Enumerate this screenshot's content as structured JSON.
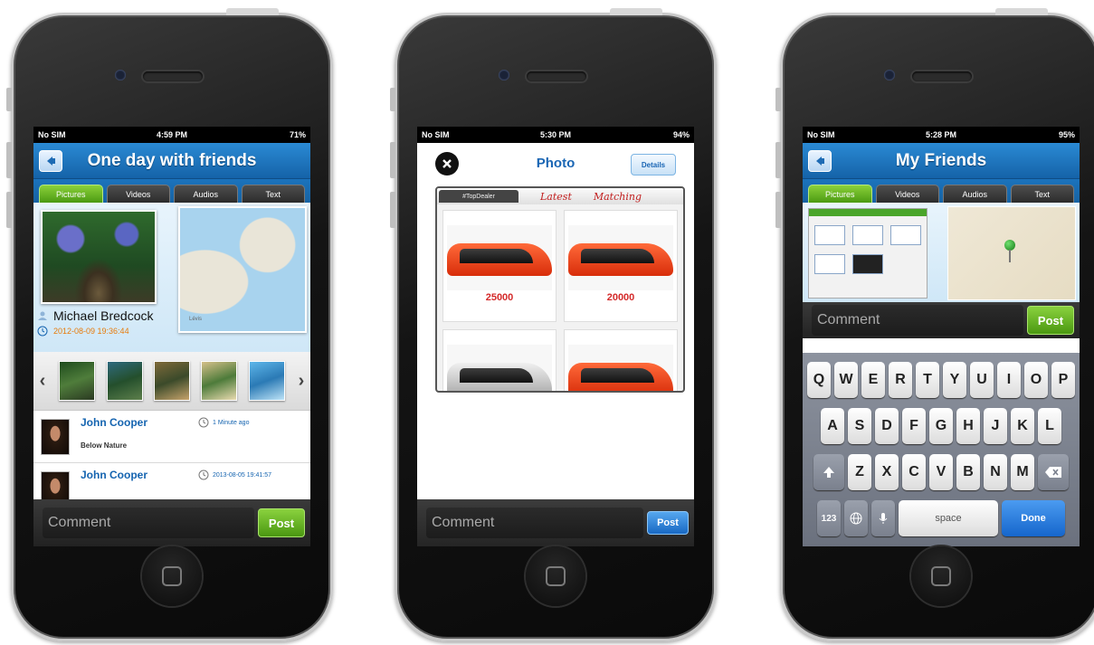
{
  "phones": [
    {
      "status": {
        "carrier": "No SIM",
        "time": "4:59 PM",
        "battery": "71%"
      },
      "nav_title": "One day with friends",
      "tabs": [
        "Pictures",
        "Videos",
        "Audios",
        "Text"
      ],
      "author": "Michael Bredcock",
      "date": "2012-08-09 19:36:44",
      "map_label": "Lévis",
      "comments": [
        {
          "name": "John Cooper",
          "time": "1 Minute ago",
          "text": "Below Nature"
        },
        {
          "name": "John Cooper",
          "time": "2013-08-05 19:41:57",
          "text": ""
        }
      ],
      "comment_placeholder": "Comment",
      "post_label": "Post"
    },
    {
      "status": {
        "carrier": "No SIM",
        "time": "5:30 PM",
        "battery": "94%"
      },
      "title": "Photo",
      "details_label": "Details",
      "strip_tab": "#TopDealer",
      "strip_text_1": "Latest",
      "strip_text_2": "Matching",
      "prices": [
        "25000",
        "20000"
      ],
      "comment_placeholder": "Comment",
      "post_label": "Post"
    },
    {
      "status": {
        "carrier": "No SIM",
        "time": "5:28 PM",
        "battery": "95%"
      },
      "nav_title": "My Friends",
      "tabs": [
        "Pictures",
        "Videos",
        "Audios",
        "Text"
      ],
      "comment_placeholder": "Comment",
      "post_label": "Post",
      "keyboard": {
        "row1": [
          "Q",
          "W",
          "E",
          "R",
          "T",
          "Y",
          "U",
          "I",
          "O",
          "P"
        ],
        "row2": [
          "A",
          "S",
          "D",
          "F",
          "G",
          "H",
          "J",
          "K",
          "L"
        ],
        "row3": [
          "Z",
          "X",
          "C",
          "V",
          "B",
          "N",
          "M"
        ],
        "numbers_key": "123",
        "space_key": "space",
        "done_key": "Done"
      }
    }
  ],
  "colors": {
    "nav_blue": "#1f78c4",
    "tab_green": "#6bb62a",
    "post_green": "#5faa1c",
    "done_blue": "#1e74d6",
    "name_blue": "#1564b0"
  }
}
